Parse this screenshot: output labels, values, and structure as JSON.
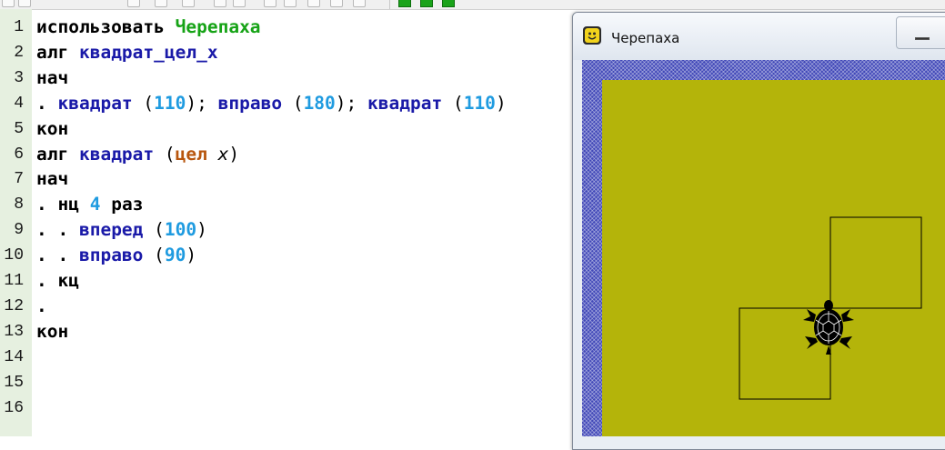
{
  "editor": {
    "line_numbers": [
      "1",
      "2",
      "3",
      "4",
      "5",
      "6",
      "7",
      "8",
      "9",
      "10",
      "11",
      "12",
      "13",
      "14",
      "15",
      "16"
    ],
    "lines": [
      [
        {
          "t": "использовать ",
          "c": "kw"
        },
        {
          "t": "Черепаха",
          "c": "mod"
        }
      ],
      [
        {
          "t": "алг ",
          "c": "kw"
        },
        {
          "t": "квадрат_цел_",
          "c": "fn"
        },
        {
          "t": "x",
          "c": "fn"
        }
      ],
      [
        {
          "t": "нач",
          "c": "kw"
        }
      ],
      [
        {
          "t": ".",
          "c": "dot"
        },
        {
          "t": " квадрат",
          "c": "fn"
        },
        {
          "t": " (",
          "c": "pun"
        },
        {
          "t": "110",
          "c": "num"
        },
        {
          "t": "); ",
          "c": "pun"
        },
        {
          "t": "вправо",
          "c": "fn"
        },
        {
          "t": " (",
          "c": "pun"
        },
        {
          "t": "180",
          "c": "num"
        },
        {
          "t": "); ",
          "c": "pun"
        },
        {
          "t": "квадрат",
          "c": "fn"
        },
        {
          "t": " (",
          "c": "pun"
        },
        {
          "t": "110",
          "c": "num"
        },
        {
          "t": ")",
          "c": "pun"
        }
      ],
      [
        {
          "t": "кон",
          "c": "kw"
        }
      ],
      [
        {
          "t": "алг ",
          "c": "kw"
        },
        {
          "t": "квадрат",
          "c": "fn"
        },
        {
          "t": " (",
          "c": "pun"
        },
        {
          "t": "цел",
          "c": "typ"
        },
        {
          "t": " x",
          "c": "par"
        },
        {
          "t": ")",
          "c": "pun"
        }
      ],
      [
        {
          "t": "нач",
          "c": "kw"
        }
      ],
      [
        {
          "t": ".",
          "c": "dot"
        },
        {
          "t": " нц ",
          "c": "kw"
        },
        {
          "t": "4",
          "c": "num"
        },
        {
          "t": " раз",
          "c": "kw"
        }
      ],
      [
        {
          "t": ".",
          "c": "dot"
        },
        {
          "t": " .",
          "c": "dot"
        },
        {
          "t": " вперед",
          "c": "fn"
        },
        {
          "t": " (",
          "c": "pun"
        },
        {
          "t": "100",
          "c": "num"
        },
        {
          "t": ")",
          "c": "pun"
        }
      ],
      [
        {
          "t": ".",
          "c": "dot"
        },
        {
          "t": " .",
          "c": "dot"
        },
        {
          "t": " вправо",
          "c": "fn"
        },
        {
          "t": " (",
          "c": "pun"
        },
        {
          "t": "90",
          "c": "num"
        },
        {
          "t": ")",
          "c": "pun"
        }
      ],
      [
        {
          "t": ".",
          "c": "dot"
        },
        {
          "t": " кц",
          "c": "kw"
        }
      ],
      [
        {
          "t": ".",
          "c": "dot"
        }
      ],
      [
        {
          "t": "кон",
          "c": "kw"
        }
      ],
      [],
      [],
      []
    ]
  },
  "turtle_window": {
    "title": "Черепаха",
    "icon": "smiley-app-icon",
    "minimize_icon": "minimize-icon",
    "canvas_color": "#b4b40a",
    "frame_color": "#4148b8",
    "turtle_icon": "turtle-icon"
  },
  "colors": {
    "keyword": "#000000",
    "module": "#16a316",
    "function": "#1a1aa8",
    "number": "#1f9be0",
    "type": "#b8560e",
    "gutter": "#e6f0e0"
  }
}
